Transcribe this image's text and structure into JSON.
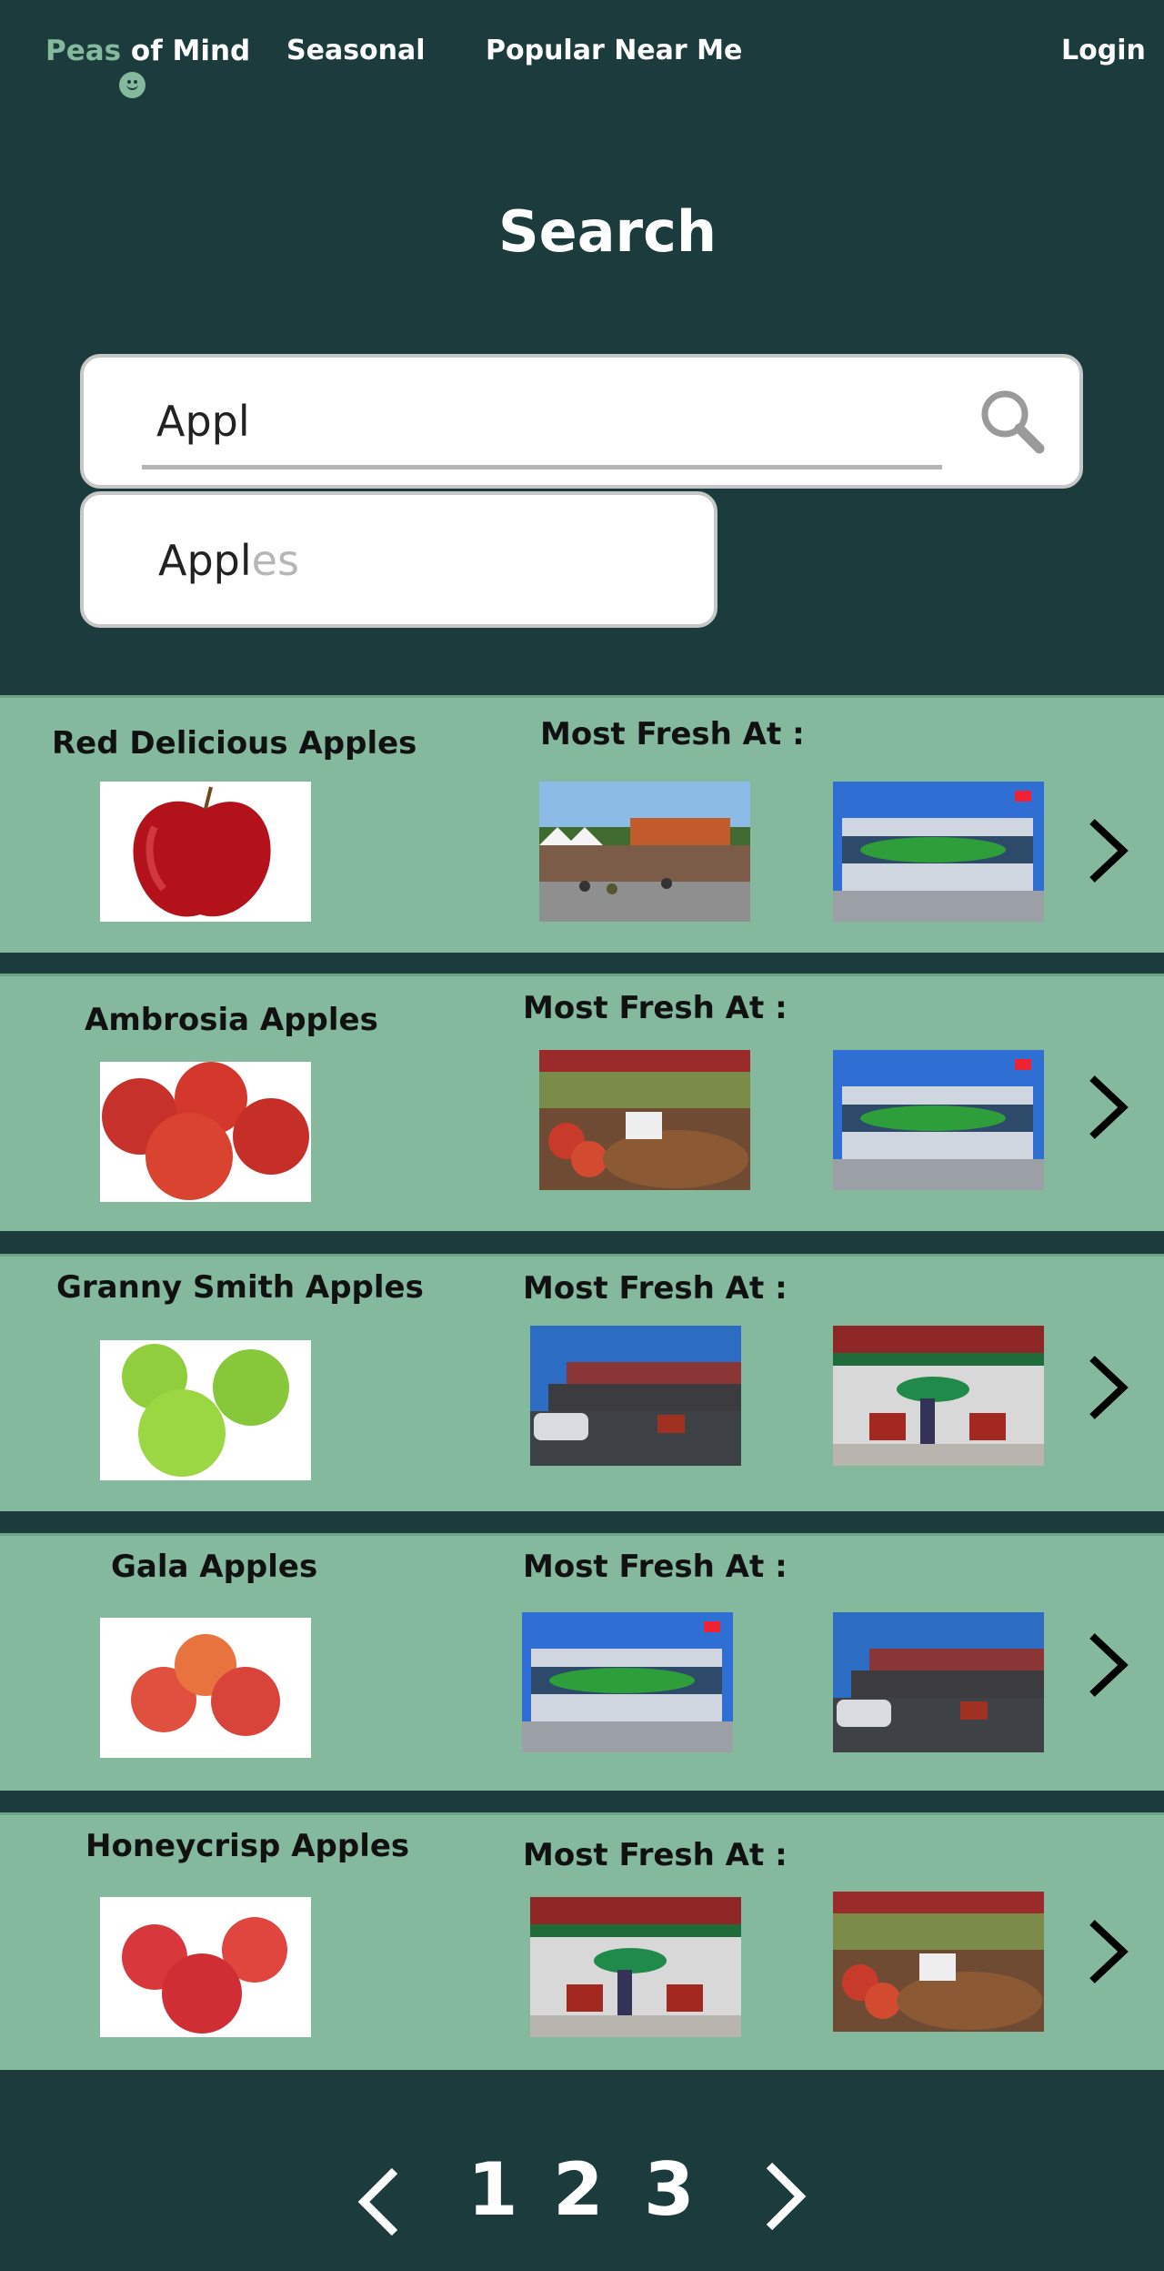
{
  "nav": {
    "brand_peas": "Peas",
    "brand_rest": "of Mind",
    "links": [
      "Seasonal",
      "Popular Near Me"
    ],
    "login": "Login"
  },
  "search": {
    "title": "Search",
    "value": "Appl",
    "suggestion_typed": "Appl",
    "suggestion_rest": "es"
  },
  "fresh_label": "Most Fresh At :",
  "results": [
    {
      "name": "Red Delicious Apples",
      "product": "red-delicious-apple",
      "stores": [
        "farmers-market",
        "save-on-foods"
      ]
    },
    {
      "name": "Ambrosia Apples",
      "product": "ambrosia-apples",
      "stores": [
        "produce-bins",
        "save-on-foods"
      ]
    },
    {
      "name": "Granny Smith Apples",
      "product": "granny-smith-apples",
      "stores": [
        "langley-farm-market",
        "farm-market-stand"
      ]
    },
    {
      "name": "Gala Apples",
      "product": "gala-apples",
      "stores": [
        "save-on-foods",
        "langley-farm-market"
      ]
    },
    {
      "name": "Honeycrisp Apples",
      "product": "honeycrisp-apples",
      "stores": [
        "farm-market-stand",
        "produce-bins"
      ]
    }
  ],
  "pagination": [
    "1",
    "2",
    "3"
  ],
  "colors": {
    "background": "#1b3b3d",
    "card": "#84b99d",
    "brand_accent": "#84b99d"
  }
}
